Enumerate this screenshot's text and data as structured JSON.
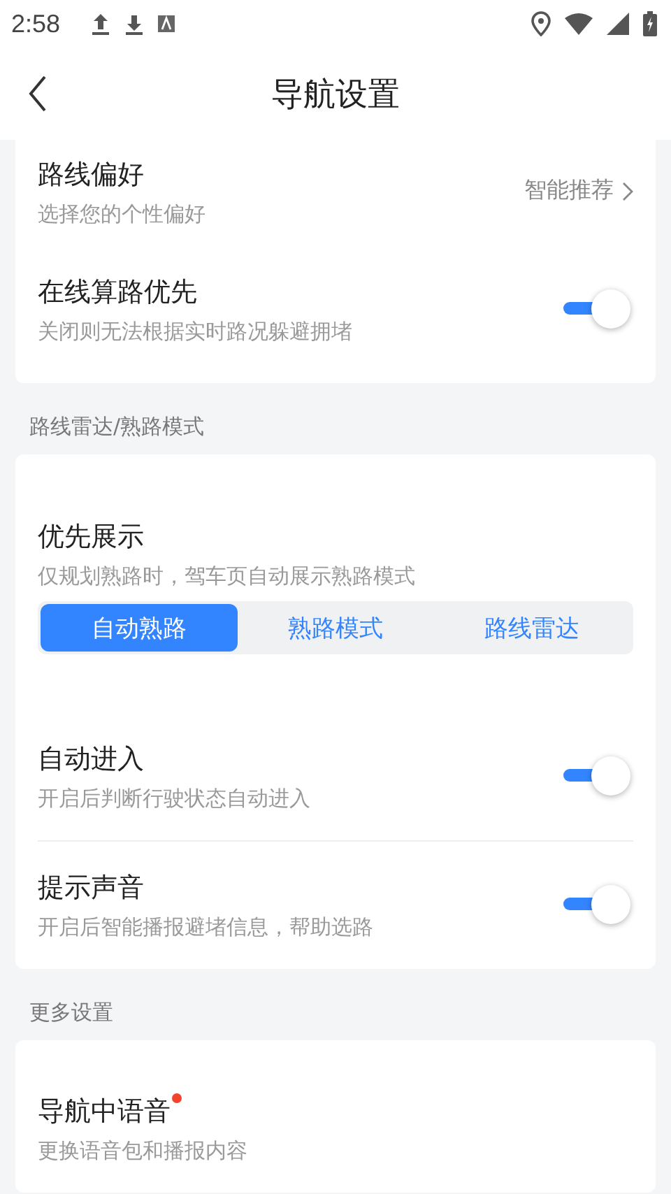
{
  "status_bar": {
    "time": "2:58"
  },
  "header": {
    "title": "导航设置"
  },
  "sections": [
    {
      "rows": [
        {
          "kind": "link",
          "title": "路线偏好",
          "subtitle": "选择您的个性偏好",
          "value": "智能推荐"
        },
        {
          "kind": "toggle",
          "title": "在线算路优先",
          "subtitle": "关闭则无法根据实时路况躲避拥堵",
          "on": true
        }
      ]
    },
    {
      "label": "路线雷达/熟路模式",
      "rows": [
        {
          "kind": "segmented",
          "title": "优先展示",
          "subtitle": "仅规划熟路时，驾车页自动展示熟路模式",
          "options": [
            {
              "label": "自动熟路",
              "selected": true
            },
            {
              "label": "熟路模式",
              "selected": false
            },
            {
              "label": "路线雷达",
              "selected": false
            }
          ]
        },
        {
          "kind": "toggle",
          "title": "自动进入",
          "subtitle": "开启后判断行驶状态自动进入",
          "on": true
        },
        {
          "kind": "toggle",
          "title": "提示声音",
          "subtitle": "开启后智能播报避堵信息，帮助选路",
          "on": true
        }
      ]
    },
    {
      "label": "更多设置",
      "rows": [
        {
          "kind": "plain",
          "title": "导航中语音",
          "subtitle": "更换语音包和播报内容",
          "badge": true
        }
      ]
    }
  ]
}
